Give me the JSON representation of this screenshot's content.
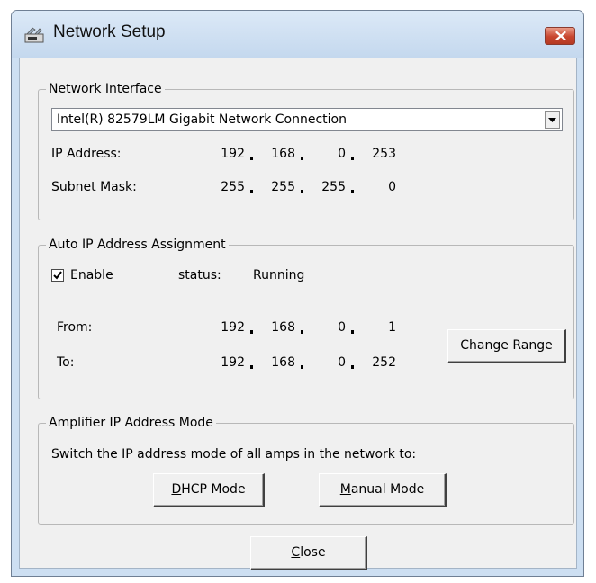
{
  "window": {
    "title": "Network Setup",
    "icon": "network-setup-icon"
  },
  "network_interface": {
    "legend": "Network Interface",
    "adapter": "Intel(R) 82579LM Gigabit Network Connection",
    "ip_label": "IP Address:",
    "ip": [
      "192",
      "168",
      "0",
      "253"
    ],
    "mask_label": "Subnet Mask:",
    "mask": [
      "255",
      "255",
      "255",
      "0"
    ]
  },
  "auto_ip": {
    "legend": "Auto IP Address Assignment",
    "enable_label": "Enable",
    "enabled": true,
    "status_label": "status:",
    "status_value": "Running",
    "from_label": "From:",
    "from": [
      "192",
      "168",
      "0",
      "1"
    ],
    "to_label": "To:",
    "to": [
      "192",
      "168",
      "0",
      "252"
    ],
    "change_range_label": "Change Range"
  },
  "amp_mode": {
    "legend": "Amplifier IP Address Mode",
    "description": "Switch the IP address mode of all amps in the network to:",
    "dhcp_mnemonic": "D",
    "dhcp_rest": "HCP Mode",
    "manual_mnemonic": "M",
    "manual_rest": "anual Mode"
  },
  "footer": {
    "close_mnemonic": "C",
    "close_rest": "lose"
  }
}
